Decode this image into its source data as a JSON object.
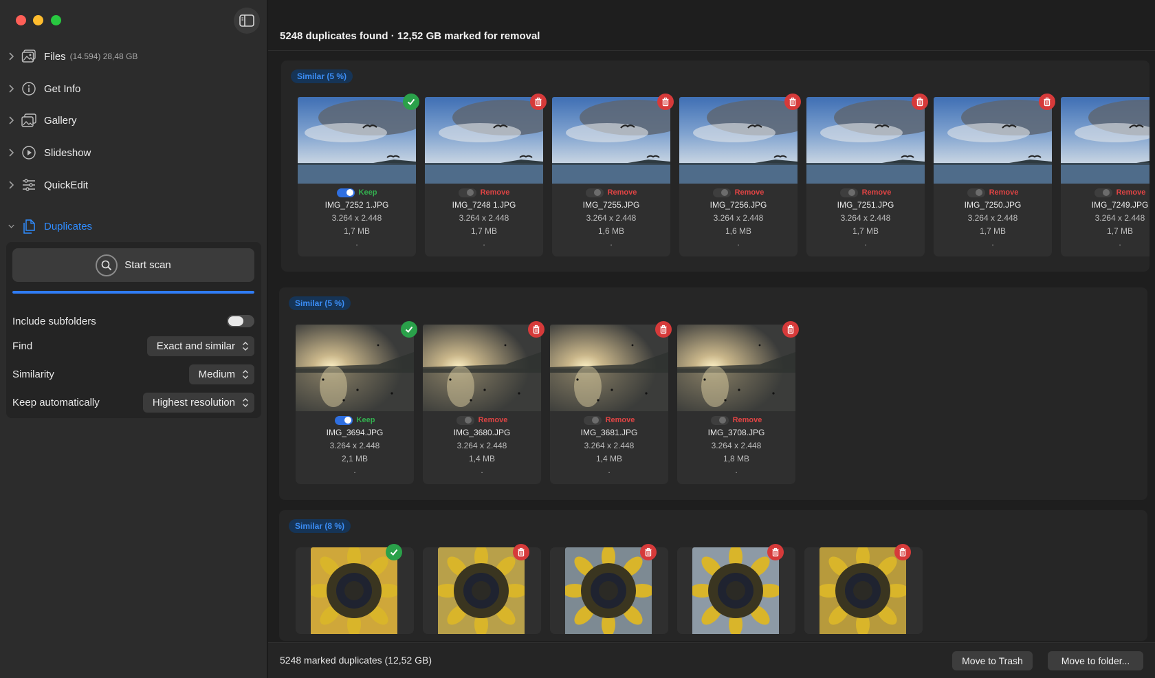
{
  "sidebar": {
    "items": [
      {
        "label": "Files",
        "meta": "(14.594) 28,48 GB",
        "icon": "photos-icon"
      },
      {
        "label": "Get Info",
        "icon": "info-icon"
      },
      {
        "label": "Gallery",
        "icon": "gallery-icon"
      },
      {
        "label": "Slideshow",
        "icon": "play-icon"
      },
      {
        "label": "QuickEdit",
        "icon": "sliders-icon"
      },
      {
        "label": "Duplicates",
        "icon": "duplicates-icon"
      }
    ],
    "duplicates": {
      "start_scan": "Start scan",
      "progress": 1.0,
      "include_subfolders": {
        "label": "Include subfolders",
        "on": false
      },
      "find": {
        "label": "Find",
        "value": "Exact and similar"
      },
      "similarity": {
        "label": "Similarity",
        "value": "Medium"
      },
      "keep_auto": {
        "label": "Keep automatically",
        "value": "Highest resolution"
      }
    }
  },
  "header": {
    "title": "5248 duplicates found · 12,52 GB marked for removal"
  },
  "groups": [
    {
      "badge": "Similar (5 %)",
      "items": [
        {
          "status": "Keep",
          "name": "IMG_7252 1.JPG",
          "dim": "3.264 x 2.448",
          "size": "1,7 MB",
          "dot": "."
        },
        {
          "status": "Remove",
          "name": "IMG_7248 1.JPG",
          "dim": "3.264 x 2.448",
          "size": "1,7 MB",
          "dot": "."
        },
        {
          "status": "Remove",
          "name": "IMG_7255.JPG",
          "dim": "3.264 x 2.448",
          "size": "1,6 MB",
          "dot": "."
        },
        {
          "status": "Remove",
          "name": "IMG_7256.JPG",
          "dim": "3.264 x 2.448",
          "size": "1,6 MB",
          "dot": "."
        },
        {
          "status": "Remove",
          "name": "IMG_7251.JPG",
          "dim": "3.264 x 2.448",
          "size": "1,7 MB",
          "dot": "."
        },
        {
          "status": "Remove",
          "name": "IMG_7250.JPG",
          "dim": "3.264 x 2.448",
          "size": "1,7 MB",
          "dot": "."
        },
        {
          "status": "Remove",
          "name": "IMG_7249.JPG",
          "dim": "3.264 x 2.448",
          "size": "1,7 MB",
          "dot": "."
        }
      ]
    },
    {
      "badge": "Similar (5 %)",
      "items": [
        {
          "status": "Keep",
          "name": "IMG_3694.JPG",
          "dim": "3.264 x 2.448",
          "size": "2,1 MB",
          "dot": "."
        },
        {
          "status": "Remove",
          "name": "IMG_3680.JPG",
          "dim": "3.264 x 2.448",
          "size": "1,4 MB",
          "dot": "."
        },
        {
          "status": "Remove",
          "name": "IMG_3681.JPG",
          "dim": "3.264 x 2.448",
          "size": "1,4 MB",
          "dot": "."
        },
        {
          "status": "Remove",
          "name": "IMG_3708.JPG",
          "dim": "3.264 x 2.448",
          "size": "1,8 MB",
          "dot": "."
        }
      ]
    },
    {
      "badge": "Similar (8 %)",
      "items": [
        {
          "status": "Keep"
        },
        {
          "status": "Remove"
        },
        {
          "status": "Remove"
        },
        {
          "status": "Remove"
        },
        {
          "status": "Remove"
        }
      ]
    }
  ],
  "footer": {
    "summary": "5248 marked duplicates (12,52 GB)",
    "trash_button": "Move to Trash",
    "folder_button": "Move to folder..."
  },
  "colors": {
    "accent": "#2f8cff",
    "keep": "#2aa14a",
    "remove": "#d63a3a"
  }
}
